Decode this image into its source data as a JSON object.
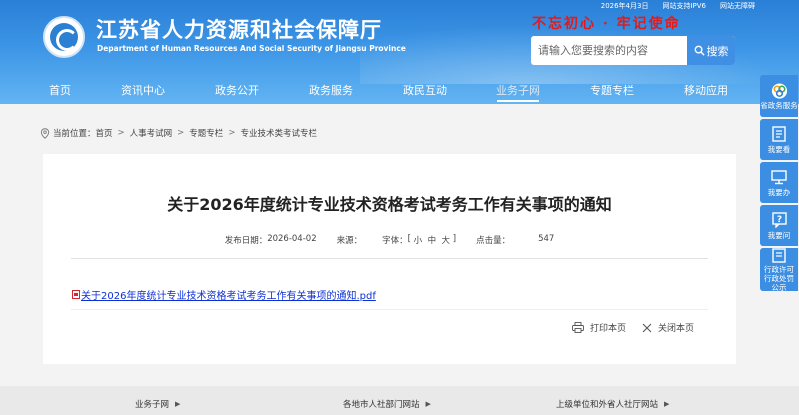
{
  "header": {
    "date": "2026年4月3日",
    "ipv6": "网站支持IPV6",
    "accessibility": "网站无障碍",
    "title": "江苏省人力资源和社会保障厅",
    "subtitle": "Department of Human Resources And Social Security of Jiangsu Province",
    "slogan": "不忘初心 · 牢记使命",
    "logo_icon": "department-logo"
  },
  "search": {
    "placeholder": "请输入您要搜索的内容",
    "button_label": "搜索",
    "icon": "search-icon"
  },
  "nav": {
    "active": "业务子网",
    "items": [
      "首页",
      "资讯中心",
      "政务公开",
      "政务服务",
      "政民互动",
      "业务子网",
      "专题专栏",
      "移动应用"
    ]
  },
  "breadcrumb": {
    "prefix": "当前位置：",
    "items": [
      "首页",
      "人事考试网",
      "专题专栏",
      "专业技术类考试专栏"
    ],
    "icon": "location-pin-icon"
  },
  "article": {
    "title": "关于2026年度统计专业技术资格考试考务工作有关事项的通知",
    "date_label": "发布日期：",
    "date": "2026-04-02",
    "source_label": "来源：",
    "source": "",
    "font_label": "字体：",
    "font_sizes": [
      "小",
      "中",
      "大"
    ],
    "views_label": "点击量：",
    "views": "547",
    "attachment": "关于2026年度统计专业技术资格考试考务工作有关事项的通知.pdf",
    "print_label": "打印本页",
    "close_label": "关闭本页"
  },
  "footer": {
    "items": [
      "业务子网",
      "各地市人社部门网站",
      "上级单位和外省人社厅网站"
    ]
  },
  "sidebar": {
    "items": [
      {
        "label": "省政务服务",
        "icon": "gov-service-icon"
      },
      {
        "label": "我要看",
        "icon": "document-icon"
      },
      {
        "label": "我要办",
        "icon": "computer-icon"
      },
      {
        "label": "我要问",
        "icon": "question-icon"
      },
      {
        "label": "行政许可行政处罚公示",
        "icon": "notice-icon"
      }
    ]
  },
  "colors": {
    "header_blue": "#2a7fd6",
    "sidebar_blue": "#3b8ee2",
    "slogan_red": "#e11b1b",
    "link_blue": "#0d2fd6"
  }
}
